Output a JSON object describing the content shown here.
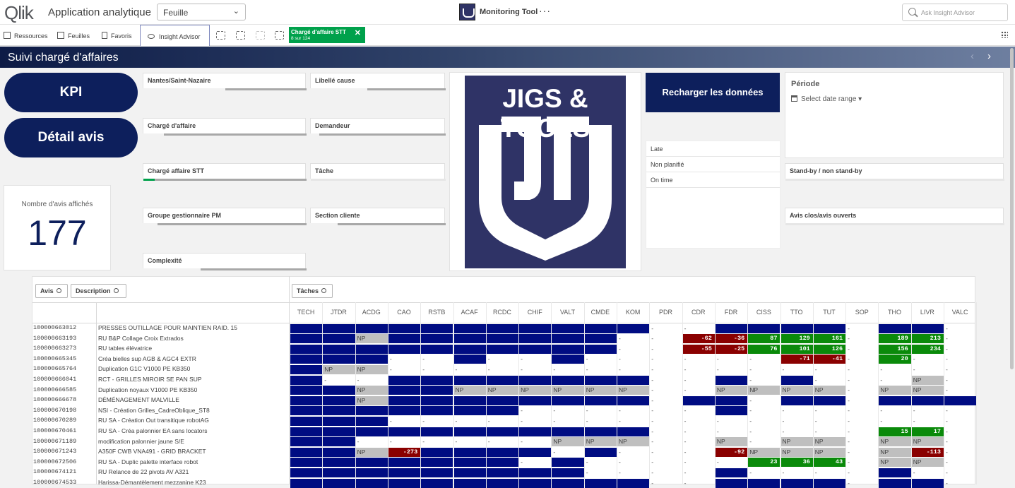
{
  "header": {
    "logo_text": "Qlik",
    "app_title": "Application analytique",
    "sheet_selector": "Feuille",
    "center_title": "Monitoring Tool",
    "more": "···",
    "search_placeholder": "Ask Insight Advisor"
  },
  "toolbar": {
    "resources": "Ressources",
    "sheets": "Feuilles",
    "favorites": "Favoris",
    "insight_advisor": "Insight Advisor",
    "selection_chip": {
      "field": "Chargé d'affaire STT",
      "count": "8 sur 124"
    }
  },
  "sheet": {
    "title": "Suivi chargé d'affaires"
  },
  "buttons": {
    "kpi": "KPI",
    "detail": "Détail avis",
    "reload": "Recharger les données"
  },
  "kpi": {
    "label": "Nombre d'avis affichés",
    "value": "177"
  },
  "filters": [
    {
      "label": "Nantes/Saint-Nazaire"
    },
    {
      "label": "Libellé cause"
    },
    {
      "label": "Chargé d'affaire"
    },
    {
      "label": "Demandeur"
    },
    {
      "label": "Chargé affaire STT"
    },
    {
      "label": "Tâche"
    },
    {
      "label": "Groupe gestionnaire PM"
    },
    {
      "label": "Section cliente"
    },
    {
      "label": "Complexité"
    }
  ],
  "logo_card": {
    "text": "JIGS & TOOLS"
  },
  "status_list": [
    "Late",
    "Non planifié",
    "On time"
  ],
  "period": {
    "title": "Période",
    "placeholder": "Select date range ▾"
  },
  "right_filters": [
    {
      "label": "Stand-by / non stand-by"
    },
    {
      "label": "Avis clos/avis ouverts"
    }
  ],
  "table": {
    "dims": [
      "Avis",
      "Description",
      "Tâches"
    ],
    "columns": [
      "TECH",
      "JTDR",
      "ACDG",
      "CAO",
      "RSTB",
      "ACAF",
      "RCDC",
      "CHIF",
      "VALT",
      "CMDE",
      "KOM",
      "PDR",
      "CDR",
      "FDR",
      "CISS",
      "TTO",
      "TUT",
      "SOP",
      "THO",
      "LIVR",
      "VALC"
    ],
    "rows": [
      {
        "id": "100000663012",
        "desc": "PRESSES OUTILLAGE POUR MAINTIEN RAID. 15",
        "cells": [
          "B",
          "B",
          "B",
          "B",
          "B",
          "B",
          "B",
          "B",
          "B",
          "B",
          "B",
          "-",
          "-",
          "B",
          "B",
          "B",
          "B",
          "-",
          "B",
          "B",
          "-"
        ]
      },
      {
        "id": "100000663193",
        "desc": "RU B&P Collage Croix Extrados",
        "cells": [
          "B",
          "B",
          "NP",
          "B",
          "B",
          "B",
          "B",
          "B",
          "B",
          "B",
          "-",
          "-",
          "r:-62",
          "r:-36",
          "g:87",
          "g:129",
          "g:161",
          "-",
          "g:189",
          "g:213",
          "-"
        ]
      },
      {
        "id": "100000663273",
        "desc": "RU tables élévatrice",
        "cells": [
          "B",
          "B",
          "B",
          "B",
          "B",
          "B",
          "B",
          "B",
          "B",
          "B",
          "-",
          "-",
          "r:-55",
          "r:-25",
          "g:76",
          "g:101",
          "g:126",
          "-",
          "g:156",
          "g:234",
          "-"
        ]
      },
      {
        "id": "100000665345",
        "desc": "Créa bielles sup AGB & AGC4 EXTR",
        "cells": [
          "B",
          "B",
          "B",
          "-",
          "-",
          "B",
          "-",
          "-",
          "B",
          "-",
          "-",
          "-",
          "-",
          "-",
          "-",
          "r:-71",
          "r:-41",
          "-",
          "g:20",
          "-",
          "-"
        ]
      },
      {
        "id": "100000665764",
        "desc": "Duplication G1C V1000 PE KB350",
        "cells": [
          "B",
          "NP",
          "NP",
          "-",
          "-",
          "-",
          "-",
          "-",
          "-",
          "-",
          "-",
          "-",
          "-",
          "-",
          "-",
          "-",
          "-",
          "-",
          "-",
          "-",
          "-"
        ]
      },
      {
        "id": "100000666041",
        "desc": "RCT - GRILLES MIROIR SE PAN SUP",
        "cells": [
          "B",
          "-",
          "-",
          "B",
          "B",
          "B",
          "B",
          "B",
          "B",
          "B",
          "B",
          "-",
          "-",
          "B",
          "-",
          "B",
          "-",
          "-",
          "-",
          "NP",
          "-"
        ]
      },
      {
        "id": "100000666585",
        "desc": "Duplication noyaux V1000 PE KB350",
        "cells": [
          "B",
          "B",
          "NP",
          "B",
          "B",
          "NP",
          "NP",
          "NP",
          "NP",
          "NP",
          "NP",
          "-",
          "-",
          "NP",
          "NP",
          "NP",
          "NP",
          "-",
          "NP",
          "NP",
          "-"
        ]
      },
      {
        "id": "100000666678",
        "desc": "DÉMÉNAGEMENT MALVILLE",
        "cells": [
          "B",
          "B",
          "NP",
          "B",
          "B",
          "B",
          "B",
          "B",
          "B",
          "B",
          "B",
          "-",
          "B",
          "B",
          "-",
          "B",
          "B",
          "-",
          "B",
          "B",
          "B"
        ]
      },
      {
        "id": "100000670198",
        "desc": "NSI - Création Grilles_CadreOblique_ST8",
        "cells": [
          "B",
          "B",
          "B",
          "B",
          "B",
          "B",
          "B",
          "-",
          "-",
          "-",
          "-",
          "-",
          "-",
          "B",
          "-",
          "-",
          "-",
          "-",
          "-",
          "-",
          "-"
        ]
      },
      {
        "id": "100000670289",
        "desc": "RU SA - Création Out transitique robotAG",
        "cells": [
          "B",
          "B",
          "B",
          "-",
          "-",
          "-",
          "-",
          "-",
          "-",
          "-",
          "-",
          "-",
          "-",
          "-",
          "-",
          "-",
          "-",
          "-",
          "-",
          "-",
          "-"
        ]
      },
      {
        "id": "100000670461",
        "desc": "RU SA - Créa palonnier EA sans locators",
        "cells": [
          "B",
          "B",
          "B",
          "B",
          "B",
          "B",
          "B",
          "B",
          "B",
          "B",
          "B",
          "-",
          "-",
          "-",
          "-",
          "-",
          "-",
          "-",
          "g:15",
          "g:17",
          "-"
        ]
      },
      {
        "id": "100000671189",
        "desc": "modification palonnier jaune S/E",
        "cells": [
          "B",
          "B",
          "-",
          "-",
          "-",
          "-",
          "-",
          "-",
          "NP",
          "NP",
          "NP",
          "-",
          "-",
          "NP",
          "-",
          "NP",
          "NP",
          "-",
          "NP",
          "NP",
          "-"
        ]
      },
      {
        "id": "100000671243",
        "desc": "A350F CWB VNA491 - GRID BRACKET",
        "cells": [
          "B",
          "B",
          "NP",
          "r:-273",
          "B",
          "B",
          "B",
          "B",
          "-",
          "B",
          "-",
          "-",
          "-",
          "r:-92",
          "NP",
          "NP",
          "NP",
          "-",
          "NP",
          "r:-113",
          "-"
        ]
      },
      {
        "id": "100000672506",
        "desc": "RU SA - Duplic palette interface robot",
        "cells": [
          "B",
          "B",
          "B",
          "B",
          "B",
          "B",
          "B",
          "-",
          "B",
          "-",
          "-",
          "-",
          "-",
          "-",
          "g:23",
          "g:36",
          "g:43",
          "-",
          "NP",
          "NP",
          "-"
        ]
      },
      {
        "id": "100000674121",
        "desc": "RU Relance de 22 pivots AV A321",
        "cells": [
          "B",
          "B",
          "B",
          "B",
          "B",
          "B",
          "B",
          "B",
          "B",
          "-",
          "-",
          "-",
          "-",
          "B",
          "-",
          "-",
          "-",
          "-",
          "B",
          "-",
          "-"
        ]
      },
      {
        "id": "100000674533",
        "desc": "Harissa-Démantèlement mezzanine K23",
        "cells": [
          "B",
          "B",
          "B",
          "B",
          "B",
          "B",
          "B",
          "B",
          "B",
          "B",
          "B",
          "-",
          "-",
          "B",
          "B",
          "B",
          "B",
          "-",
          "B",
          "B",
          "-"
        ]
      }
    ]
  },
  "colors": {
    "navy": "#0d1f5c",
    "cell_blue": "#000c82",
    "red": "#8a0000",
    "green": "#0a8a0a",
    "np_grey": "#bfbfbf",
    "selection_green": "#00a14b"
  }
}
